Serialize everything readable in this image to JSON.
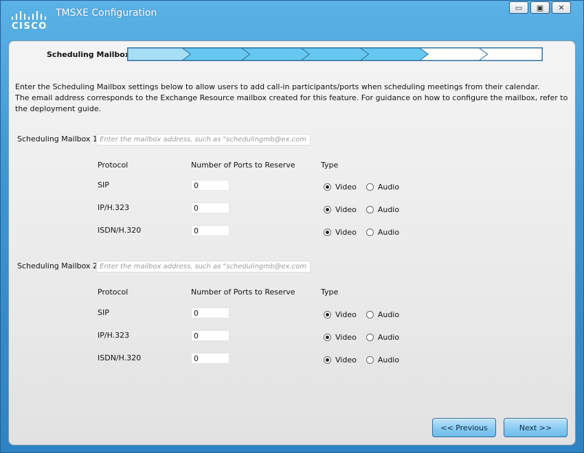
{
  "window": {
    "title": "TMSXE Configuration",
    "brand": "CISCO",
    "controls": {
      "minimize": "▭",
      "maximize": "▣",
      "close": "✕"
    }
  },
  "wizard": {
    "step_label": "Scheduling Mailbox",
    "steps_total": 7,
    "steps_completed": 5,
    "accent": "#66c8f0"
  },
  "intro": {
    "line1": "Enter the Scheduling Mailbox settings below to allow users to add call-in participants/ports when scheduling meetings from their calendar.",
    "line2": "The email address corresponds to the Exchange Resource mailbox created for this feature. For guidance on how to configure the mailbox, refer to the deployment guide."
  },
  "columns": {
    "protocol": "Protocol",
    "ports": "Number of Ports to Reserve",
    "type": "Type"
  },
  "type_options": {
    "video": "Video",
    "audio": "Audio"
  },
  "mailboxes": [
    {
      "label": "Scheduling Mailbox 1",
      "value": "",
      "placeholder": "Enter the mailbox address, such as \"schedulingmb@ex.com\".",
      "rows": [
        {
          "protocol": "SIP",
          "ports": "0",
          "type": "video"
        },
        {
          "protocol": "IP/H.323",
          "ports": "0",
          "type": "video"
        },
        {
          "protocol": "ISDN/H.320",
          "ports": "0",
          "type": "video"
        }
      ]
    },
    {
      "label": "Scheduling Mailbox 2",
      "value": "",
      "placeholder": "Enter the mailbox address, such as \"schedulingmb@ex.com\".",
      "rows": [
        {
          "protocol": "SIP",
          "ports": "0",
          "type": "video"
        },
        {
          "protocol": "IP/H.323",
          "ports": "0",
          "type": "video"
        },
        {
          "protocol": "ISDN/H.320",
          "ports": "0",
          "type": "video"
        }
      ]
    }
  ],
  "buttons": {
    "previous": "<< Previous",
    "next": "Next >>"
  }
}
